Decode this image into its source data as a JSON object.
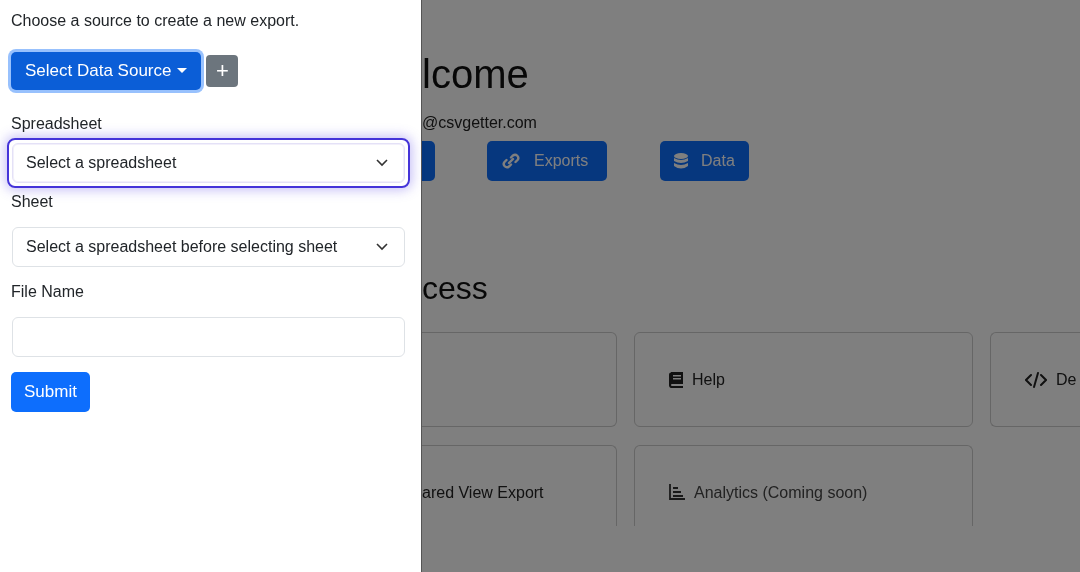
{
  "page": {
    "heading": "lcome",
    "email": "@csvgetter.com",
    "nav_buttons": [
      {
        "kind": "partial"
      },
      {
        "kind": "link",
        "label": "Exports"
      },
      {
        "kind": "database",
        "label": "Data"
      }
    ],
    "section_heading": "cess",
    "cards": [
      {
        "kind": "blank"
      },
      {
        "kind": "book",
        "label": "Help"
      },
      {
        "kind": "code",
        "label": "De"
      },
      {
        "kind": "plain",
        "label": "ared View Export"
      },
      {
        "kind": "chart",
        "label": "Analytics (Coming soon)"
      }
    ]
  },
  "panel": {
    "intro": "Choose a source to create a new export.",
    "source_button": {
      "label": "Select Data Source",
      "focused": true
    },
    "add_button": "+",
    "fields": [
      {
        "kind": "select",
        "label": "Spreadsheet",
        "value": "Select a spreadsheet",
        "focused": true
      },
      {
        "kind": "select",
        "label": "Sheet",
        "value": "Select a spreadsheet before selecting sheet",
        "focused": false
      },
      {
        "kind": "text",
        "label": "File Name",
        "focused": false
      }
    ],
    "submit": "Submit"
  }
}
